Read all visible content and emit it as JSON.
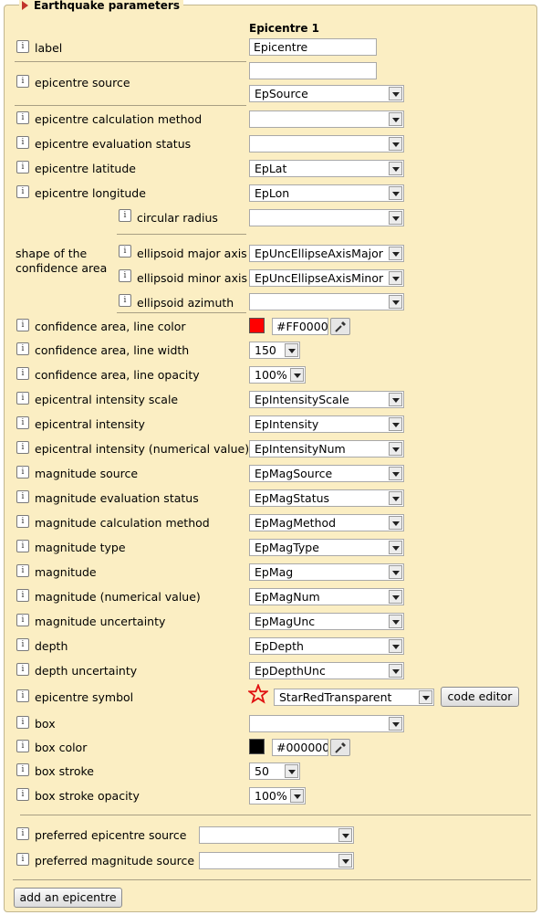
{
  "panel": {
    "title": "Earthquake parameters"
  },
  "column_header": "Epicentre 1",
  "rows": {
    "label": {
      "label": "label",
      "value": "Epicentre"
    },
    "epicentre_source": {
      "label": "epicentre source",
      "text_value": "",
      "select_value": "EpSource"
    },
    "calc_method": {
      "label": "epicentre calculation method",
      "value": ""
    },
    "eval_status": {
      "label": "epicentre evaluation status",
      "value": ""
    },
    "latitude": {
      "label": "epicentre latitude",
      "value": "EpLat"
    },
    "longitude": {
      "label": "epicentre longitude",
      "value": "EpLon"
    },
    "shape": {
      "label": "shape of the confidence area",
      "label_line1": "shape of the",
      "label_line2": "confidence area",
      "circular_radius": {
        "label": "circular radius",
        "value": ""
      },
      "major_axis": {
        "label": "ellipsoid major axis",
        "value": "EpUncEllipseAxisMajor"
      },
      "minor_axis": {
        "label": "ellipsoid minor axis",
        "value": "EpUncEllipseAxisMinor"
      },
      "azimuth": {
        "label": "ellipsoid azimuth",
        "value": ""
      }
    },
    "conf_color": {
      "label": "confidence area, line color",
      "value": "#FF0000",
      "swatch": "#FF0000"
    },
    "conf_width": {
      "label": "confidence area, line width",
      "value": "150"
    },
    "conf_opacity": {
      "label": "confidence area, line opacity",
      "value": "100%"
    },
    "int_scale": {
      "label": "epicentral intensity scale",
      "value": "EpIntensityScale"
    },
    "intensity": {
      "label": "epicentral intensity",
      "value": "EpIntensity"
    },
    "intensity_num": {
      "label": "epicentral intensity (numerical value)",
      "value": "EpIntensityNum"
    },
    "mag_source": {
      "label": "magnitude source",
      "value": "EpMagSource"
    },
    "mag_status": {
      "label": "magnitude evaluation status",
      "value": "EpMagStatus"
    },
    "mag_method": {
      "label": "magnitude calculation method",
      "value": "EpMagMethod"
    },
    "mag_type": {
      "label": "magnitude type",
      "value": "EpMagType"
    },
    "magnitude": {
      "label": "magnitude",
      "value": "EpMag"
    },
    "mag_num": {
      "label": "magnitude (numerical value)",
      "value": "EpMagNum"
    },
    "mag_unc": {
      "label": "magnitude uncertainty",
      "value": "EpMagUnc"
    },
    "depth": {
      "label": "depth",
      "value": "EpDepth"
    },
    "depth_unc": {
      "label": "depth uncertainty",
      "value": "EpDepthUnc"
    },
    "symbol": {
      "label": "epicentre symbol",
      "value": "StarRedTransparent",
      "icon": "red-star-icon",
      "button": "code editor"
    },
    "box": {
      "label": "box",
      "value": ""
    },
    "box_color": {
      "label": "box color",
      "value": "#000000",
      "swatch": "#000000"
    },
    "box_stroke": {
      "label": "box stroke",
      "value": "50"
    },
    "box_opacity": {
      "label": "box stroke opacity",
      "value": "100%"
    },
    "pref_epi": {
      "label": "preferred epicentre source",
      "value": ""
    },
    "pref_mag": {
      "label": "preferred magnitude source",
      "value": ""
    }
  },
  "info_glyph": "i",
  "add_button": "add an epicentre",
  "colors": {
    "panel_bg": "#fbeec3",
    "legend_arrow": "#c1332a",
    "star": "#e01010"
  }
}
